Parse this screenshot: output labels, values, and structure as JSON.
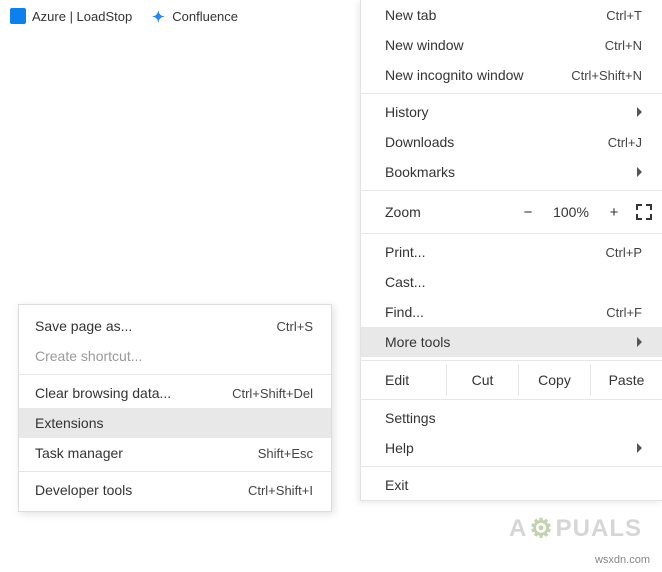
{
  "bookmarks": [
    {
      "label": "Azure | LoadStop",
      "icon": "azure"
    },
    {
      "label": "Confluence",
      "icon": "confluence"
    }
  ],
  "mainMenu": {
    "newTab": {
      "label": "New tab",
      "shortcut": "Ctrl+T"
    },
    "newWindow": {
      "label": "New window",
      "shortcut": "Ctrl+N"
    },
    "newIncognito": {
      "label": "New incognito window",
      "shortcut": "Ctrl+Shift+N"
    },
    "history": {
      "label": "History"
    },
    "downloads": {
      "label": "Downloads",
      "shortcut": "Ctrl+J"
    },
    "bookmarks": {
      "label": "Bookmarks"
    },
    "zoom": {
      "label": "Zoom",
      "minus": "−",
      "value": "100%",
      "plus": "+"
    },
    "print": {
      "label": "Print...",
      "shortcut": "Ctrl+P"
    },
    "cast": {
      "label": "Cast..."
    },
    "find": {
      "label": "Find...",
      "shortcut": "Ctrl+F"
    },
    "moreTools": {
      "label": "More tools"
    },
    "edit": {
      "label": "Edit",
      "cut": "Cut",
      "copy": "Copy",
      "paste": "Paste"
    },
    "settings": {
      "label": "Settings"
    },
    "help": {
      "label": "Help"
    },
    "exit": {
      "label": "Exit"
    }
  },
  "subMenu": {
    "savePageAs": {
      "label": "Save page as...",
      "shortcut": "Ctrl+S"
    },
    "createShortcut": {
      "label": "Create shortcut..."
    },
    "clearBrowsing": {
      "label": "Clear browsing data...",
      "shortcut": "Ctrl+Shift+Del"
    },
    "extensions": {
      "label": "Extensions"
    },
    "taskManager": {
      "label": "Task manager",
      "shortcut": "Shift+Esc"
    },
    "devTools": {
      "label": "Developer tools",
      "shortcut": "Ctrl+Shift+I"
    }
  },
  "watermark": {
    "left": "A",
    "right": "PUALS"
  },
  "footer": "wsxdn.com"
}
